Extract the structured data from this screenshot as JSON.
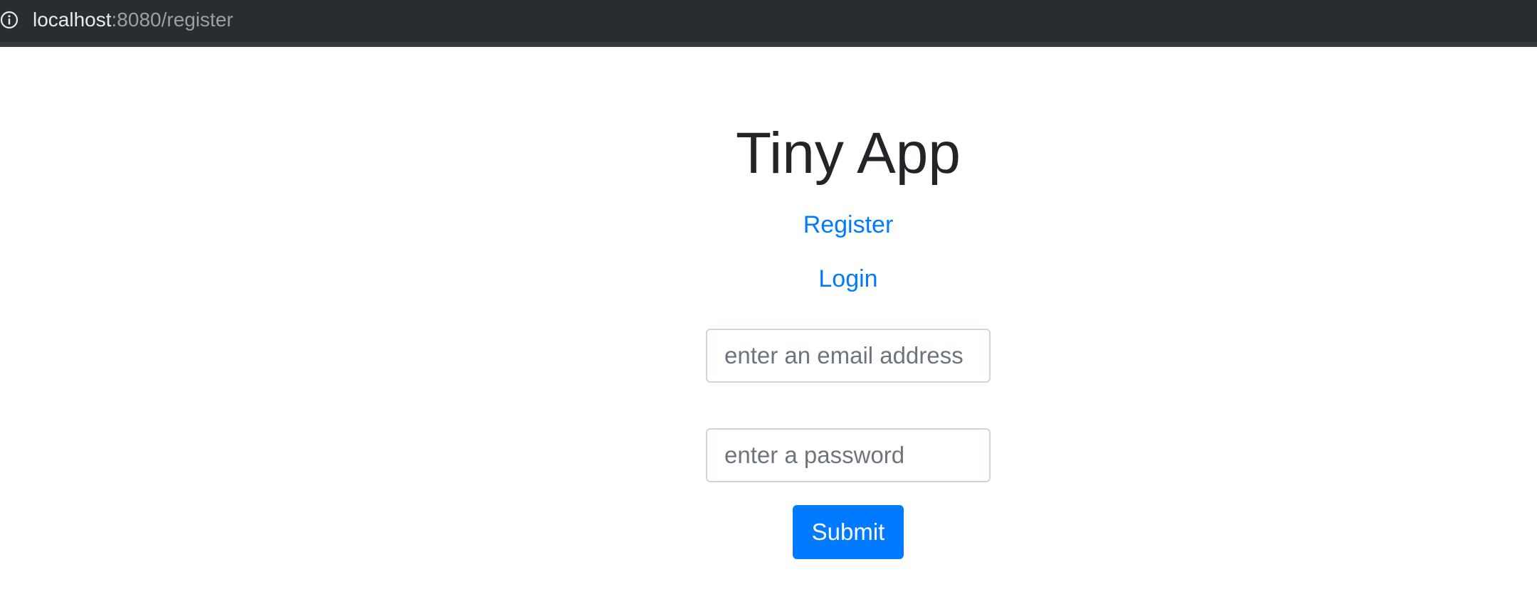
{
  "browser": {
    "url_host": "localhost",
    "url_path": ":8080/register",
    "info_icon": "info-circle-icon"
  },
  "page": {
    "title": "Tiny App",
    "nav": {
      "register_label": "Register",
      "login_label": "Login"
    }
  },
  "form": {
    "email_placeholder": "enter an email address",
    "password_placeholder": "enter a password",
    "submit_label": "Submit"
  },
  "colors": {
    "link": "#007bff",
    "button": "#007bff",
    "title": "#212529",
    "url_bar": "#2a2d30"
  }
}
